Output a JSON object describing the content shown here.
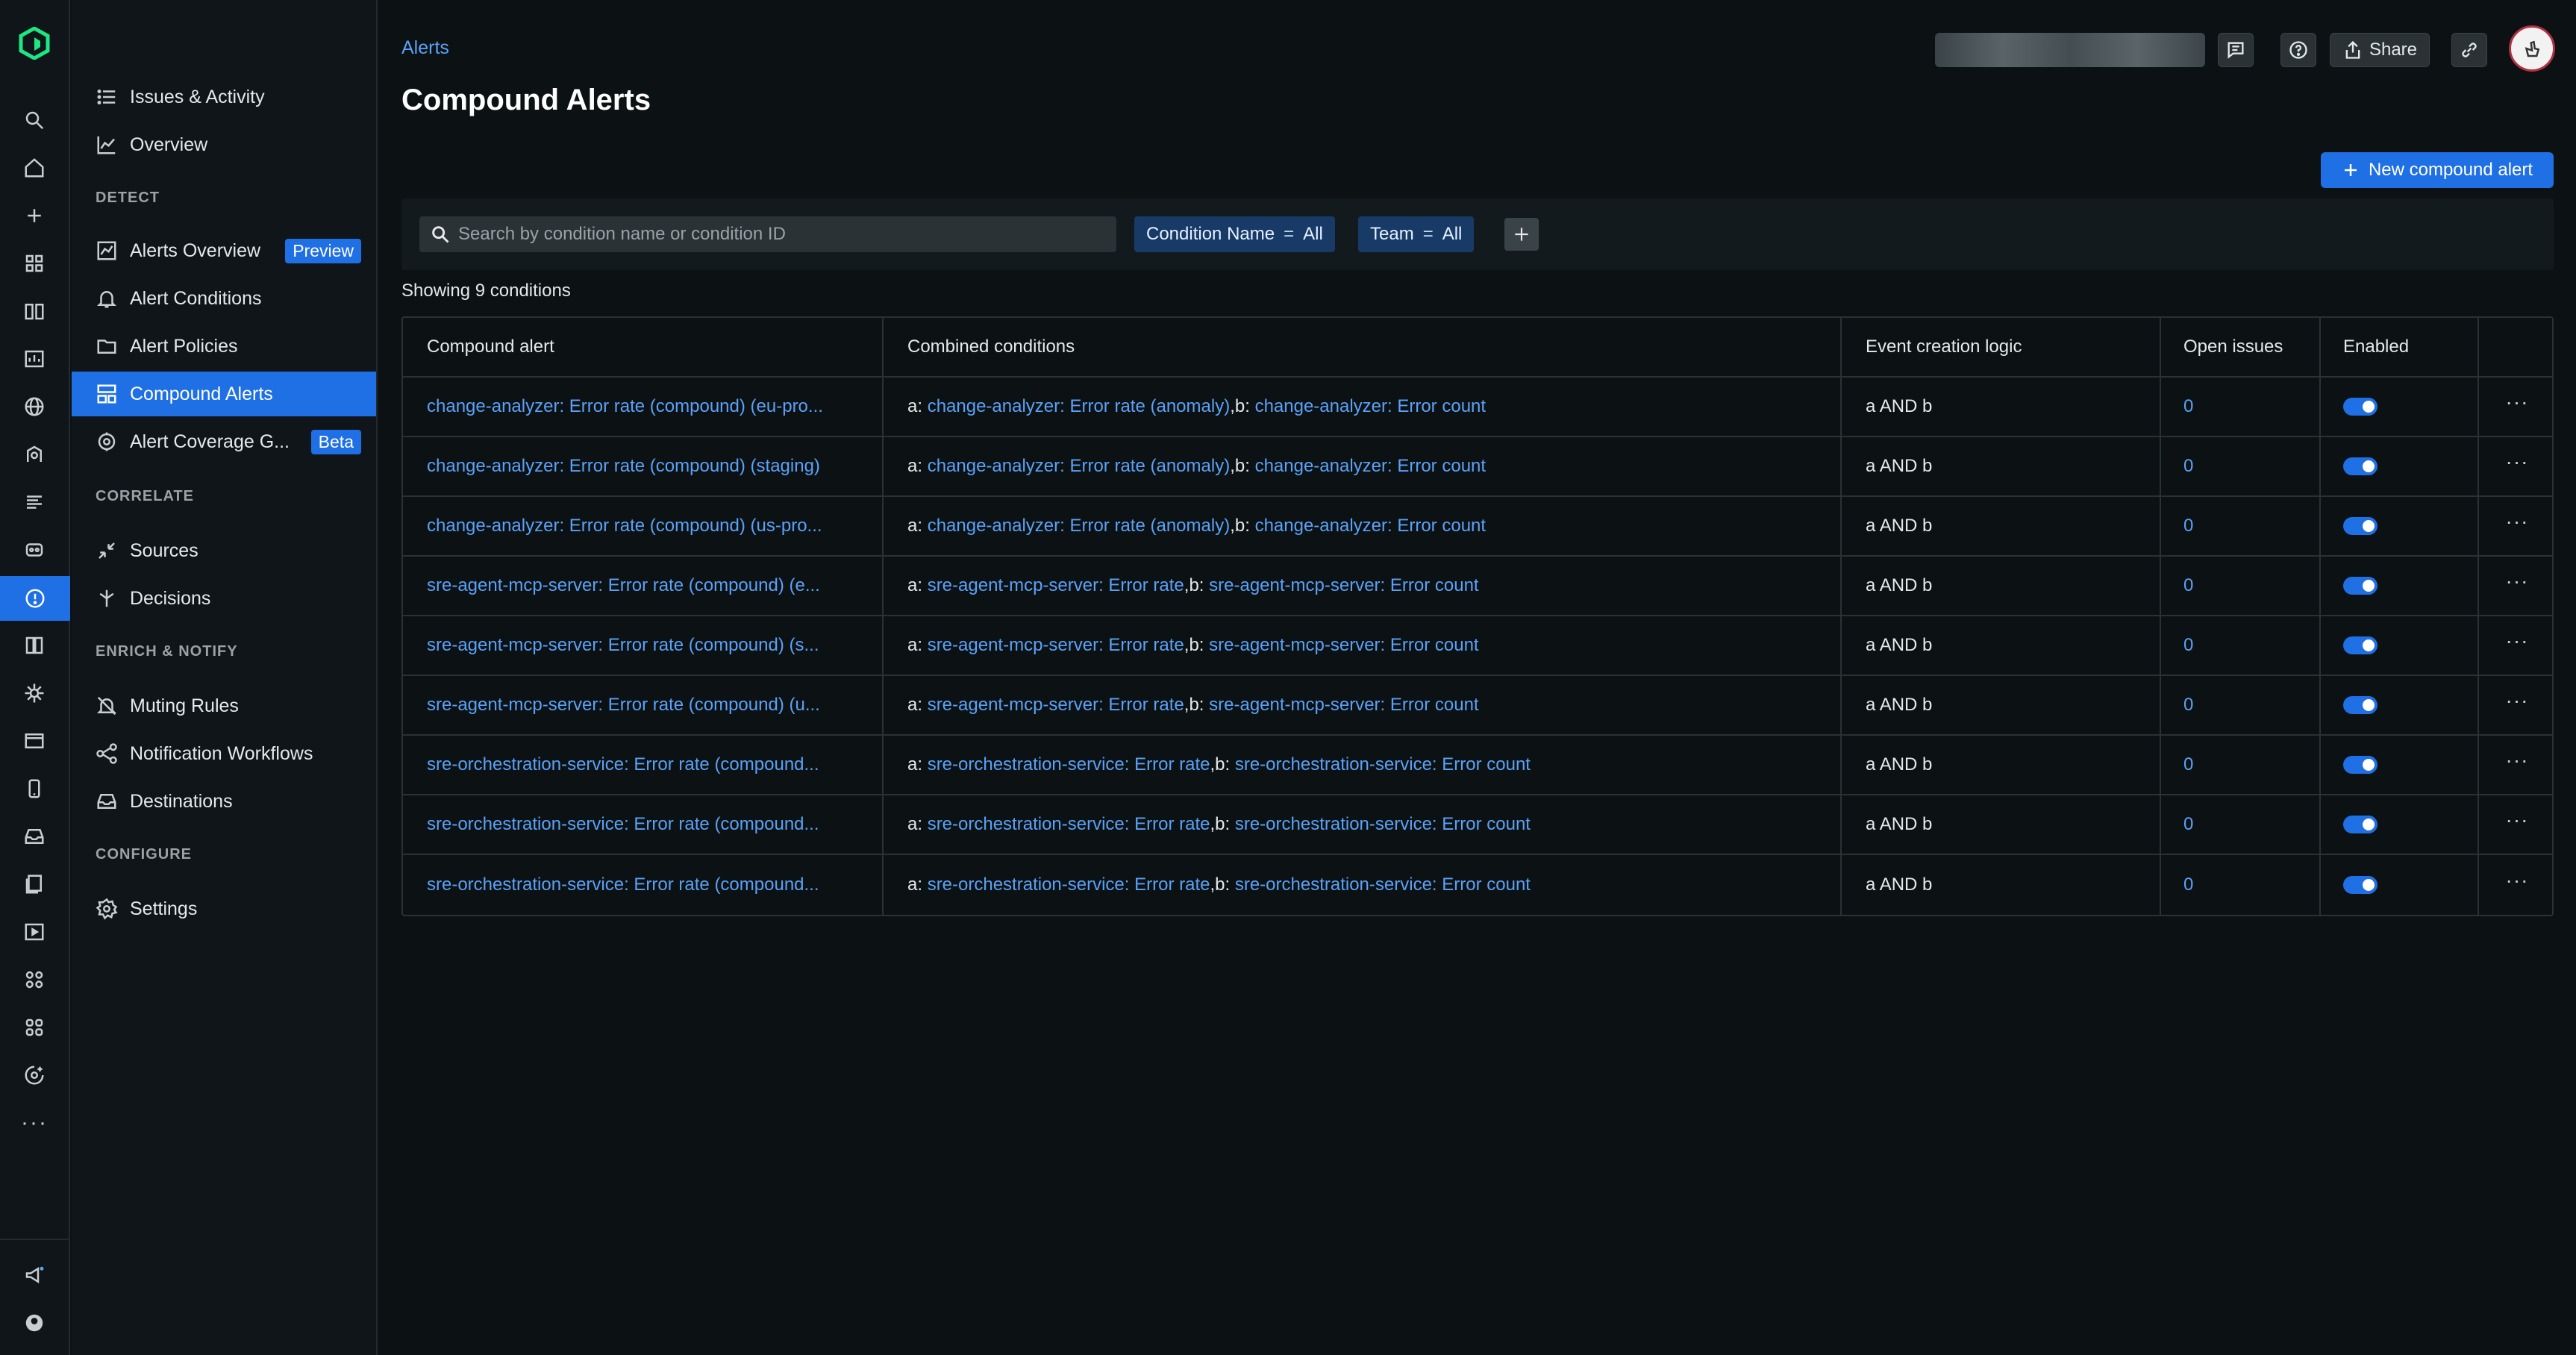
{
  "rail": {
    "icons": [
      "search-icon",
      "home-icon",
      "plus-icon",
      "apps-grid-icon",
      "book-icon",
      "dashboard-icon",
      "globe-icon",
      "apm-icon",
      "logs-icon",
      "infrastructure-icon",
      "alerts-icon",
      "query-icon",
      "kubernetes-icon",
      "browser-icon",
      "mobile-icon",
      "inbox-icon",
      "errors-icon",
      "synthetics-icon",
      "integrations-icon",
      "hub-icon",
      "ai-monitoring-icon"
    ],
    "more": "···"
  },
  "nav": {
    "issues": "Issues & Activity",
    "overview": "Overview",
    "detect_section": "DETECT",
    "alerts_overview": "Alerts Overview",
    "preview_badge": "Preview",
    "alert_conditions": "Alert Conditions",
    "alert_policies": "Alert Policies",
    "compound_alerts": "Compound Alerts",
    "alert_coverage": "Alert Coverage G...",
    "beta_badge": "Beta",
    "correlate_section": "CORRELATE",
    "sources": "Sources",
    "decisions": "Decisions",
    "enrich_section": "ENRICH & NOTIFY",
    "muting_rules": "Muting Rules",
    "notification_workflows": "Notification Workflows",
    "destinations": "Destinations",
    "configure_section": "CONFIGURE",
    "settings": "Settings"
  },
  "header": {
    "breadcrumb": "Alerts",
    "title": "Compound Alerts",
    "share_label": "Share"
  },
  "toolbar": {
    "new_button": "New compound alert",
    "search_placeholder": "Search by condition name or condition ID",
    "chip_condition_key": "Condition Name",
    "chip_condition_op": "=",
    "chip_condition_val": "All",
    "chip_team_key": "Team",
    "chip_team_op": "=",
    "chip_team_val": "All"
  },
  "summary": "Showing 9 conditions",
  "table": {
    "columns": [
      "Compound alert",
      "Combined conditions",
      "Event creation logic",
      "Open issues",
      "Enabled"
    ],
    "rows": [
      {
        "name": "change-analyzer: Error rate (compound) (eu-pro...",
        "a": "change-analyzer: Error rate (anomaly)",
        "b": "change-analyzer: Error count",
        "logic": "a AND b",
        "open": "0",
        "enabled": true
      },
      {
        "name": "change-analyzer: Error rate (compound) (staging)",
        "a": "change-analyzer: Error rate (anomaly)",
        "b": "change-analyzer: Error count",
        "logic": "a AND b",
        "open": "0",
        "enabled": true
      },
      {
        "name": "change-analyzer: Error rate (compound) (us-pro...",
        "a": "change-analyzer: Error rate (anomaly)",
        "b": "change-analyzer: Error count",
        "logic": "a AND b",
        "open": "0",
        "enabled": true
      },
      {
        "name": "sre-agent-mcp-server: Error rate (compound) (e...",
        "a": "sre-agent-mcp-server: Error rate",
        "b": "sre-agent-mcp-server: Error count",
        "logic": "a AND b",
        "open": "0",
        "enabled": true
      },
      {
        "name": "sre-agent-mcp-server: Error rate (compound) (s...",
        "a": "sre-agent-mcp-server: Error rate",
        "b": "sre-agent-mcp-server: Error count",
        "logic": "a AND b",
        "open": "0",
        "enabled": true
      },
      {
        "name": "sre-agent-mcp-server: Error rate (compound) (u...",
        "a": "sre-agent-mcp-server: Error rate",
        "b": "sre-agent-mcp-server: Error count",
        "logic": "a AND b",
        "open": "0",
        "enabled": true
      },
      {
        "name": "sre-orchestration-service: Error rate (compound...",
        "a": "sre-orchestration-service: Error rate",
        "b": "sre-orchestration-service: Error count",
        "logic": "a AND b",
        "open": "0",
        "enabled": true
      },
      {
        "name": "sre-orchestration-service: Error rate (compound...",
        "a": "sre-orchestration-service: Error rate",
        "b": "sre-orchestration-service: Error count",
        "logic": "a AND b",
        "open": "0",
        "enabled": true
      },
      {
        "name": "sre-orchestration-service: Error rate (compound...",
        "a": "sre-orchestration-service: Error rate",
        "b": "sre-orchestration-service: Error count",
        "logic": "a AND b",
        "open": "0",
        "enabled": true
      }
    ],
    "a_prefix": "a: ",
    "b_prefix": ",b: ",
    "row_menu": "···"
  },
  "colors": {
    "accent": "#1f6fe5",
    "link": "#5aa2f7",
    "background": "#0c1114"
  }
}
